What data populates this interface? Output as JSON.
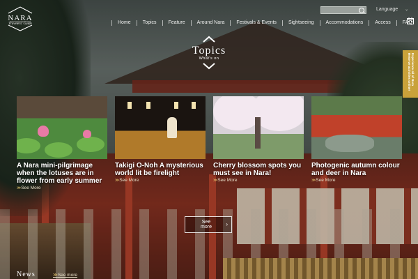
{
  "logo": {
    "name": "NARA",
    "subtitle": "Travelers' Guide"
  },
  "header": {
    "language_label": "Language",
    "language_chevron": "⌄",
    "search_placeholder": ""
  },
  "nav": {
    "items": [
      "Home",
      "Topics",
      "Feature",
      "Around Nara",
      "Festivals & Events",
      "Sightseeing",
      "Accommodations",
      "Access",
      "FAQ"
    ]
  },
  "side_tab": {
    "label": "Experience all of Nara Reserve activities online!"
  },
  "topics": {
    "title": "Topics",
    "subtitle": "What's on"
  },
  "cards": [
    {
      "title": "A Nara mini-pilgrimage when the lotuses are in flower from early summer",
      "more": "See More"
    },
    {
      "title": "Takigi O-Noh A mysterious world lit be firelight",
      "more": "See More"
    },
    {
      "title": "Cherry blossom spots you must see in Nara!",
      "more": "See More"
    },
    {
      "title": "Photogenic autumn colour and deer in Nara",
      "more": "See More"
    }
  ],
  "see_more_button": {
    "label_line1": "See",
    "label_line2": "more",
    "arrow": "›"
  },
  "news": {
    "title": "News",
    "more": "See more"
  },
  "colors": {
    "accent_gold": "#c9a23a",
    "link_arrow": "#e8c870"
  },
  "icons": {
    "search": "search-icon",
    "calendar": "calendar-icon",
    "up": "chevron-up-icon",
    "down": "chevron-down-icon"
  }
}
